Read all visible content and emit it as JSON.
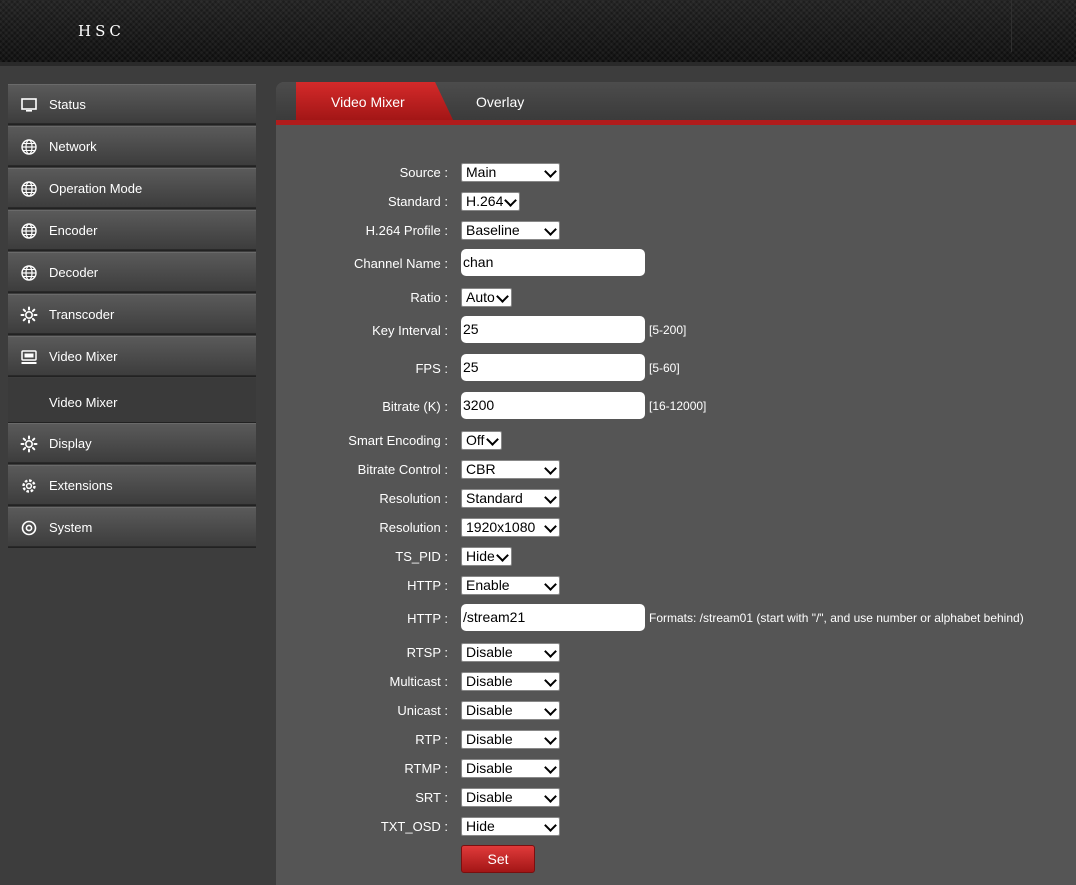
{
  "header": {
    "brand": "HSC"
  },
  "sidebar": {
    "items": [
      {
        "label": "Status",
        "icon": "monitor-icon"
      },
      {
        "label": "Network",
        "icon": "globe-icon"
      },
      {
        "label": "Operation Mode",
        "icon": "globe-icon"
      },
      {
        "label": "Encoder",
        "icon": "globe-icon"
      },
      {
        "label": "Decoder",
        "icon": "globe-icon"
      },
      {
        "label": "Transcoder",
        "icon": "gear-icon"
      },
      {
        "label": "Video Mixer",
        "icon": "video-mixer-icon"
      }
    ],
    "subitem": {
      "label": "Video Mixer"
    },
    "items_after": [
      {
        "label": "Display",
        "icon": "gear-icon"
      },
      {
        "label": "Extensions",
        "icon": "cog-icon"
      },
      {
        "label": "System",
        "icon": "target-icon"
      }
    ]
  },
  "tabs": {
    "active": "Video Mixer",
    "inactive": "Overlay"
  },
  "form": {
    "source": {
      "label": "Source :",
      "value": "Main"
    },
    "standard": {
      "label": "Standard :",
      "value": "H.264"
    },
    "profile": {
      "label": "H.264 Profile :",
      "value": "Baseline"
    },
    "channel_name": {
      "label": "Channel Name :",
      "value": "chan"
    },
    "ratio": {
      "label": "Ratio :",
      "value": "Auto"
    },
    "key_interval": {
      "label": "Key Interval :",
      "value": "25",
      "hint": "[5-200]"
    },
    "fps": {
      "label": "FPS :",
      "value": "25",
      "hint": "[5-60]"
    },
    "bitrate": {
      "label": "Bitrate (K) :",
      "value": "3200",
      "hint": "[16-12000]"
    },
    "smart_encoding": {
      "label": "Smart Encoding :",
      "value": "Off"
    },
    "bitrate_control": {
      "label": "Bitrate Control :",
      "value": "CBR"
    },
    "resolution1": {
      "label": "Resolution :",
      "value": "Standard"
    },
    "resolution2": {
      "label": "Resolution :",
      "value": "1920x1080"
    },
    "ts_pid": {
      "label": "TS_PID :",
      "value": "Hide"
    },
    "http": {
      "label": "HTTP :",
      "value": "Enable"
    },
    "http_path": {
      "label": "HTTP :",
      "value": "/stream21",
      "hint": "Formats: /stream01 (start with \"/\", and use number or alphabet behind)"
    },
    "rtsp": {
      "label": "RTSP :",
      "value": "Disable"
    },
    "multicast": {
      "label": "Multicast :",
      "value": "Disable"
    },
    "unicast": {
      "label": "Unicast :",
      "value": "Disable"
    },
    "rtp": {
      "label": "RTP :",
      "value": "Disable"
    },
    "rtmp": {
      "label": "RTMP :",
      "value": "Disable"
    },
    "srt": {
      "label": "SRT :",
      "value": "Disable"
    },
    "txt_osd": {
      "label": "TXT_OSD :",
      "value": "Hide"
    },
    "set_label": "Set"
  },
  "colors": {
    "accent": "#c41f1f",
    "panel": "#555555",
    "sidebar": "#4a4a4a"
  }
}
